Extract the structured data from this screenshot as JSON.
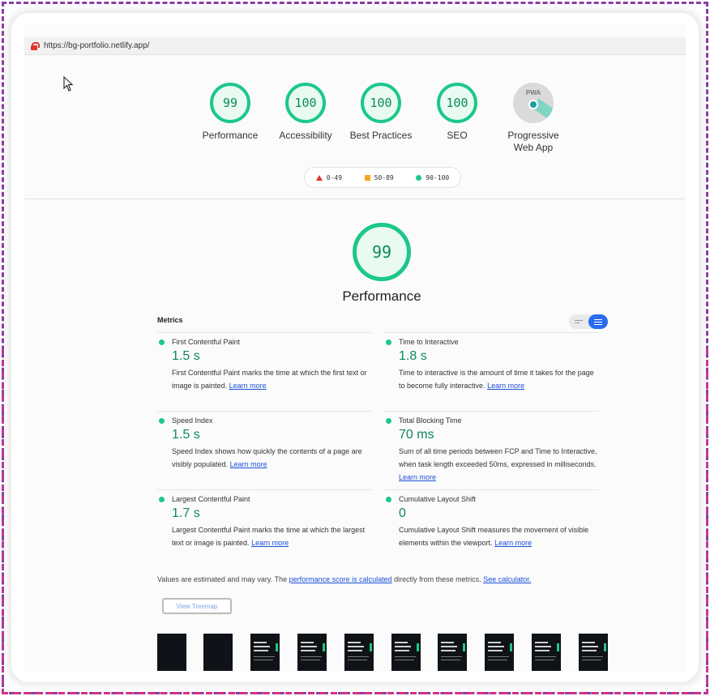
{
  "browser": {
    "url": "https://bg-portfolio.netlify.app/"
  },
  "summary_gauges": [
    {
      "score": "99",
      "label": "Performance"
    },
    {
      "score": "100",
      "label": "Accessibility"
    },
    {
      "score": "100",
      "label": "Best Practices"
    },
    {
      "score": "100",
      "label": "SEO"
    }
  ],
  "pwa": {
    "label_line1": "Progressive",
    "label_line2": "Web App",
    "badge_text": "PWA"
  },
  "legend": {
    "fail": "0-49",
    "average": "50-89",
    "pass": "90-100"
  },
  "performance": {
    "score": "99",
    "title": "Performance"
  },
  "metrics_header": "Metrics",
  "metrics": [
    {
      "name": "First Contentful Paint",
      "value": "1.5 s",
      "desc": "First Contentful Paint marks the time at which the first text or image is painted.",
      "link": "Learn more"
    },
    {
      "name": "Time to Interactive",
      "value": "1.8 s",
      "desc": "Time to interactive is the amount of time it takes for the page to become fully interactive.",
      "link": "Learn more"
    },
    {
      "name": "Speed Index",
      "value": "1.5 s",
      "desc": "Speed Index shows how quickly the contents of a page are visibly populated.",
      "link": "Learn more"
    },
    {
      "name": "Total Blocking Time",
      "value": "70 ms",
      "desc": "Sum of all time periods between FCP and Time to Interactive, when task length exceeded 50ms, expressed in milliseconds.",
      "link": "Learn more"
    },
    {
      "name": "Largest Contentful Paint",
      "value": "1.7 s",
      "desc": "Largest Contentful Paint marks the time at which the largest text or image is painted.",
      "link": "Learn more"
    },
    {
      "name": "Cumulative Layout Shift",
      "value": "0",
      "desc": "Cumulative Layout Shift measures the movement of visible elements within the viewport.",
      "link": "Learn more"
    }
  ],
  "footnote": {
    "pre": "Values are estimated and may vary. The ",
    "link1": "performance score is calculated",
    "mid": " directly from these metrics. ",
    "link2": "See calculator."
  },
  "treemap_button": "View Treemap",
  "filmstrip": {
    "thumb_text_line1": "Hi, I'm",
    "thumb_text_line2": "Biryan",
    "thumb_text_line3": "Gurer"
  },
  "colors": {
    "pass": "#1cc88a",
    "pass_text": "#0d8a5a",
    "average": "#f5a623",
    "fail": "#e0352b",
    "link": "#1a4fd6"
  }
}
